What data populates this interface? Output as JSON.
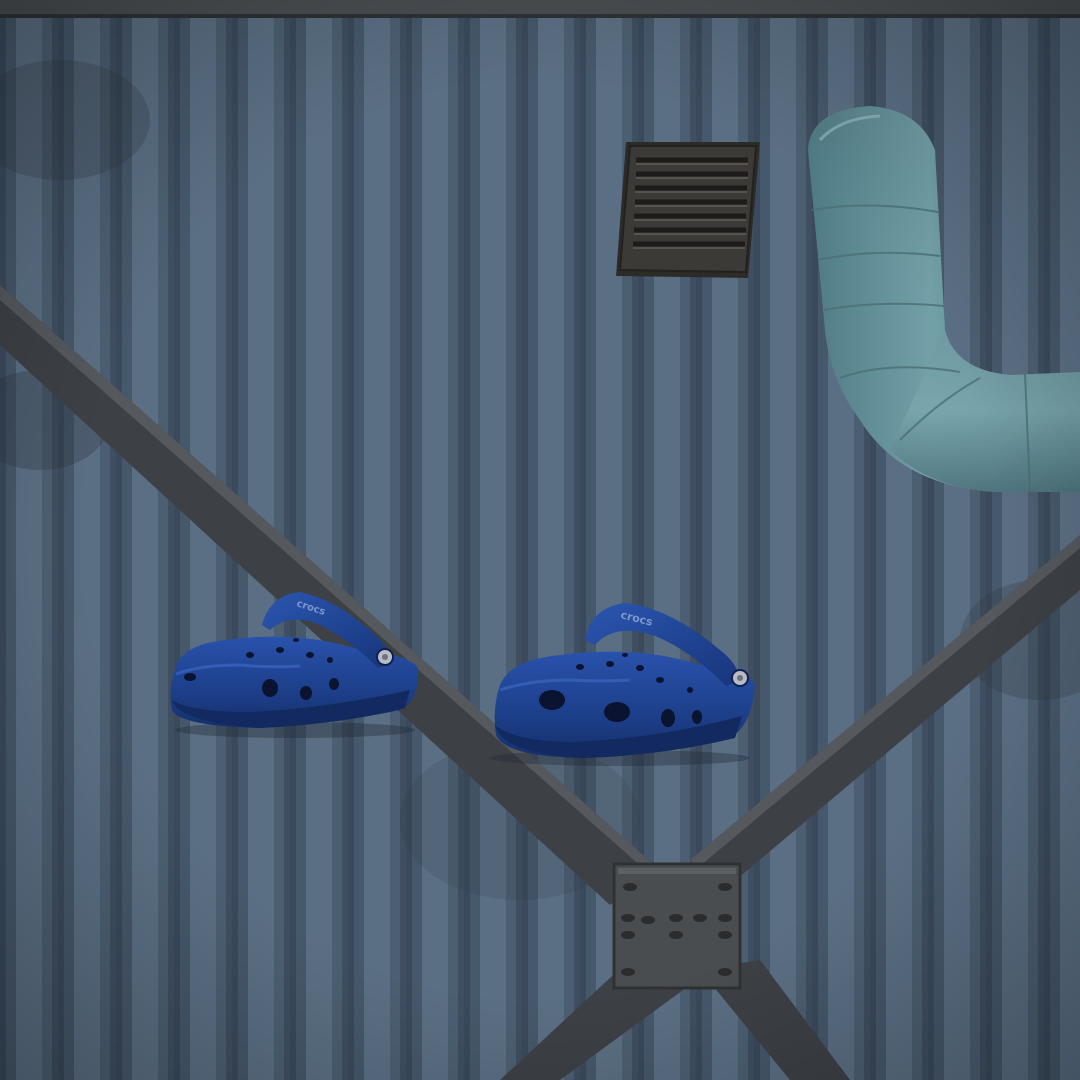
{
  "scene": {
    "kind": "game-item-preview",
    "backdrop": "corrugated-metal-wall",
    "objects": [
      "wall-vent-icon",
      "duct-pipe-icon",
      "steel-cross-brace",
      "bolted-plate",
      "left-clog-icon",
      "right-clog-icon"
    ]
  },
  "colors": {
    "wall_base": "#4f6378",
    "wall_light": "#6a7e93",
    "wall_dark": "#3a4a5b",
    "brace": "#3b3f45",
    "plate": "#4a4d50",
    "pipe": "#5f8891",
    "vent": "#3b3a36",
    "clog": "#1d3f8a",
    "clog_dark": "#122a60"
  },
  "logo": {
    "left_strap_text": "crocs",
    "right_strap_text": "crocs"
  }
}
